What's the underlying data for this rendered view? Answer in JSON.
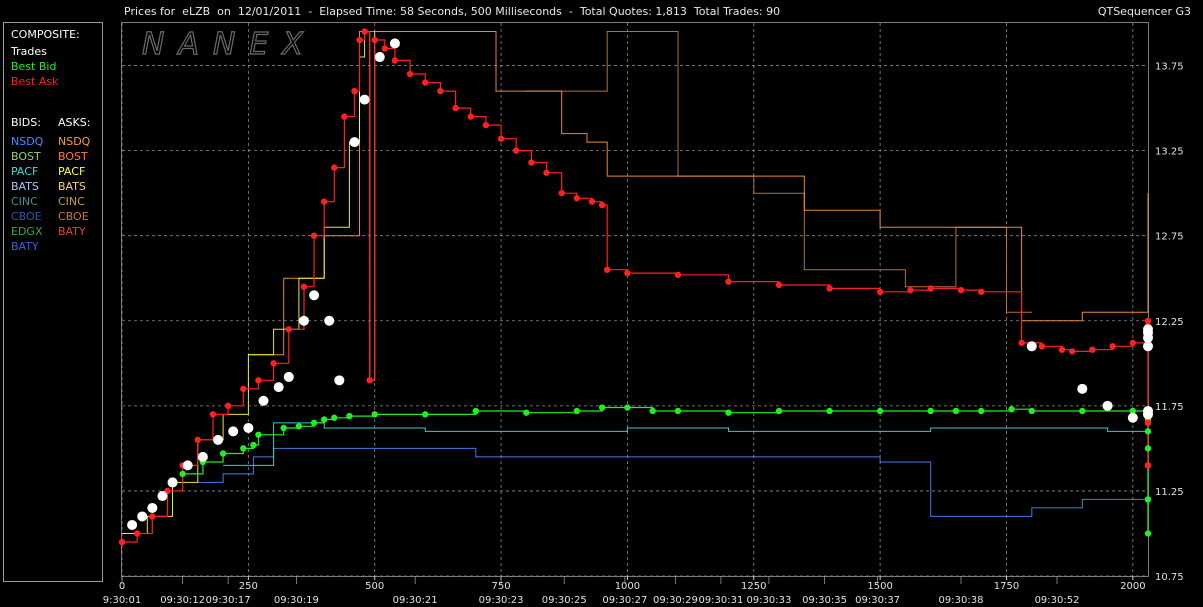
{
  "header": {
    "title": "Prices for  eLZB  on  12/01/2011  -  Elapsed Time: 58 Seconds, 500 Milliseconds  -  Total Quotes: 1,813  Total Trades: 90",
    "app_name": "QTSequencer G3"
  },
  "watermark": "NANEX",
  "legend": {
    "composite_heading": "COMPOSITE:",
    "composite": [
      {
        "label": "Trades",
        "color": "#ffffff"
      },
      {
        "label": "Best Bid",
        "color": "#22ee22"
      },
      {
        "label": "Best Ask",
        "color": "#ff2020"
      }
    ],
    "bids_heading": "BIDS:",
    "asks_heading": "ASKS:",
    "bids": [
      {
        "label": "NSDQ",
        "color": "#4a8cff"
      },
      {
        "label": "BOST",
        "color": "#9ad07a"
      },
      {
        "label": "PACF",
        "color": "#3ee0e0"
      },
      {
        "label": "BATS",
        "color": "#a8c8ff"
      },
      {
        "label": "CINC",
        "color": "#3a8fa0"
      },
      {
        "label": "CBOE",
        "color": "#2a5aa8"
      },
      {
        "label": "EDGX",
        "color": "#3aa83a"
      },
      {
        "label": "BATY",
        "color": "#3a62d8"
      }
    ],
    "asks": [
      {
        "label": "NSDQ",
        "color": "#ff9a3a"
      },
      {
        "label": "BOST",
        "color": "#ff7a3a"
      },
      {
        "label": "PACF",
        "color": "#ffff40"
      },
      {
        "label": "BATS",
        "color": "#ffd070"
      },
      {
        "label": "CINC",
        "color": "#c8a030"
      },
      {
        "label": "CBOE",
        "color": "#c87a40"
      },
      {
        "label": "BATY",
        "color": "#e04040"
      }
    ]
  },
  "chart_data": {
    "type": "line",
    "xlim": [
      0,
      2030
    ],
    "ylim": [
      10.75,
      14.0
    ],
    "grid": true,
    "x_ticks": [
      0,
      250,
      500,
      750,
      1000,
      1250,
      1500,
      1750,
      2000
    ],
    "y_ticks": [
      {
        "value": 10.75,
        "label": "10.75"
      },
      {
        "value": 11.25,
        "label": "11.25"
      },
      {
        "value": 11.75,
        "label": "11.75"
      },
      {
        "value": 12.25,
        "label": "12.25"
      },
      {
        "value": 12.75,
        "label": "12.75"
      },
      {
        "value": 13.25,
        "label": "13.25"
      },
      {
        "value": 13.75,
        "label": "13.75"
      }
    ],
    "time_labels": [
      {
        "x": 0,
        "label": "9:30:01"
      },
      {
        "x": 120,
        "label": "09:30:12"
      },
      {
        "x": 210,
        "label": "09:30:17"
      },
      {
        "x": 345,
        "label": "09:30:19"
      },
      {
        "x": 580,
        "label": "09:30:21"
      },
      {
        "x": 750,
        "label": "09:30:23"
      },
      {
        "x": 875,
        "label": "09:30:25"
      },
      {
        "x": 995,
        "label": "09:30:27"
      },
      {
        "x": 1095,
        "label": "09:30:29"
      },
      {
        "x": 1185,
        "label": "09:30:31"
      },
      {
        "x": 1280,
        "label": "09:30:33"
      },
      {
        "x": 1390,
        "label": "09:30:35"
      },
      {
        "x": 1495,
        "label": "09:30:37"
      },
      {
        "x": 1660,
        "label": "09:30:38"
      },
      {
        "x": 1850,
        "label": "09:30:52"
      }
    ],
    "series": [
      {
        "name": "Best Ask",
        "color": "#ff2020",
        "points": [
          [
            0,
            10.95
          ],
          [
            30,
            11.0
          ],
          [
            60,
            11.1
          ],
          [
            90,
            11.25
          ],
          [
            120,
            11.4
          ],
          [
            150,
            11.55
          ],
          [
            180,
            11.7
          ],
          [
            210,
            11.75
          ],
          [
            240,
            11.85
          ],
          [
            270,
            11.9
          ],
          [
            300,
            12.0
          ],
          [
            330,
            12.2
          ],
          [
            360,
            12.45
          ],
          [
            380,
            12.75
          ],
          [
            400,
            12.95
          ],
          [
            420,
            13.15
          ],
          [
            440,
            13.45
          ],
          [
            460,
            13.6
          ],
          [
            470,
            13.9
          ],
          [
            480,
            13.95
          ],
          [
            490,
            11.9
          ],
          [
            500,
            13.9
          ],
          [
            520,
            13.85
          ],
          [
            540,
            13.78
          ],
          [
            570,
            13.7
          ],
          [
            600,
            13.65
          ],
          [
            630,
            13.6
          ],
          [
            660,
            13.5
          ],
          [
            690,
            13.45
          ],
          [
            720,
            13.4
          ],
          [
            750,
            13.32
          ],
          [
            780,
            13.25
          ],
          [
            810,
            13.18
          ],
          [
            840,
            13.12
          ],
          [
            870,
            13.0
          ],
          [
            900,
            12.97
          ],
          [
            930,
            12.95
          ],
          [
            950,
            12.93
          ],
          [
            960,
            12.55
          ],
          [
            1000,
            12.53
          ],
          [
            1100,
            12.52
          ],
          [
            1200,
            12.48
          ],
          [
            1300,
            12.46
          ],
          [
            1400,
            12.44
          ],
          [
            1500,
            12.42
          ],
          [
            1560,
            12.43
          ],
          [
            1600,
            12.44
          ],
          [
            1660,
            12.43
          ],
          [
            1700,
            12.42
          ],
          [
            1780,
            12.12
          ],
          [
            1820,
            12.1
          ],
          [
            1860,
            12.08
          ],
          [
            1880,
            12.07
          ],
          [
            1920,
            12.08
          ],
          [
            1960,
            12.1
          ],
          [
            2000,
            12.12
          ],
          [
            2040,
            12.14
          ],
          [
            2080,
            12.18
          ],
          [
            2100,
            12.22
          ],
          [
            2110,
            12.25
          ],
          [
            2130,
            12.2
          ],
          [
            2150,
            12.1
          ],
          [
            2165,
            11.65
          ],
          [
            2180,
            12.18
          ],
          [
            2200,
            11.4
          ],
          [
            2230,
            11.4
          ]
        ]
      },
      {
        "name": "Best Bid",
        "color": "#22ee22",
        "points": [
          [
            120,
            11.35
          ],
          [
            160,
            11.42
          ],
          [
            200,
            11.47
          ],
          [
            240,
            11.5
          ],
          [
            260,
            11.52
          ],
          [
            270,
            11.58
          ],
          [
            320,
            11.62
          ],
          [
            350,
            11.63
          ],
          [
            380,
            11.65
          ],
          [
            400,
            11.67
          ],
          [
            420,
            11.68
          ],
          [
            450,
            11.69
          ],
          [
            500,
            11.7
          ],
          [
            600,
            11.7
          ],
          [
            700,
            11.72
          ],
          [
            800,
            11.71
          ],
          [
            900,
            11.72
          ],
          [
            950,
            11.74
          ],
          [
            1000,
            11.74
          ],
          [
            1050,
            11.72
          ],
          [
            1100,
            11.72
          ],
          [
            1200,
            11.71
          ],
          [
            1300,
            11.72
          ],
          [
            1400,
            11.72
          ],
          [
            1500,
            11.72
          ],
          [
            1600,
            11.72
          ],
          [
            1650,
            11.72
          ],
          [
            1700,
            11.72
          ],
          [
            1760,
            11.73
          ],
          [
            1800,
            11.72
          ],
          [
            1900,
            11.72
          ],
          [
            2000,
            11.72
          ],
          [
            2040,
            11.73
          ],
          [
            2060,
            11.7
          ],
          [
            2080,
            11.67
          ],
          [
            2100,
            11.65
          ],
          [
            2120,
            11.6
          ],
          [
            2150,
            11.5
          ],
          [
            2165,
            11.4
          ],
          [
            2175,
            11.2
          ],
          [
            2185,
            11.0
          ]
        ]
      },
      {
        "name": "Trades",
        "color": "#ffffff",
        "points": [
          [
            20,
            11.05
          ],
          [
            40,
            11.1
          ],
          [
            60,
            11.15
          ],
          [
            80,
            11.22
          ],
          [
            100,
            11.3
          ],
          [
            130,
            11.4
          ],
          [
            160,
            11.45
          ],
          [
            190,
            11.55
          ],
          [
            220,
            11.6
          ],
          [
            250,
            11.62
          ],
          [
            280,
            11.78
          ],
          [
            310,
            11.86
          ],
          [
            330,
            11.92
          ],
          [
            360,
            12.25
          ],
          [
            380,
            12.4
          ],
          [
            410,
            12.25
          ],
          [
            430,
            11.9
          ],
          [
            460,
            13.3
          ],
          [
            480,
            13.55
          ],
          [
            510,
            13.8
          ],
          [
            540,
            13.88
          ],
          [
            1800,
            12.1
          ],
          [
            1900,
            11.85
          ],
          [
            1950,
            11.75
          ],
          [
            2000,
            11.68
          ],
          [
            2050,
            11.7
          ],
          [
            2080,
            11.72
          ],
          [
            2100,
            12.1
          ],
          [
            2120,
            12.2
          ],
          [
            2140,
            12.15
          ],
          [
            2160,
            12.18
          ]
        ]
      },
      {
        "name": "BATS",
        "color": "#3ee0e0",
        "points": [
          [
            200,
            11.4
          ],
          [
            250,
            11.4
          ],
          [
            300,
            11.65
          ],
          [
            400,
            11.62
          ],
          [
            600,
            11.6
          ],
          [
            800,
            11.6
          ],
          [
            1000,
            11.62
          ],
          [
            1200,
            11.6
          ],
          [
            1400,
            11.6
          ],
          [
            1600,
            11.62
          ],
          [
            1700,
            11.62
          ],
          [
            1800,
            11.62
          ],
          [
            1950,
            11.6
          ],
          [
            2050,
            11.55
          ],
          [
            2100,
            11.5
          ],
          [
            2150,
            11.3
          ]
        ]
      },
      {
        "name": "NSDQ",
        "color": "#4a8cff",
        "points": [
          [
            150,
            11.3
          ],
          [
            200,
            11.35
          ],
          [
            260,
            11.45
          ],
          [
            300,
            11.5
          ],
          [
            500,
            11.5
          ],
          [
            700,
            11.45
          ],
          [
            900,
            11.45
          ],
          [
            1100,
            11.45
          ],
          [
            1300,
            11.45
          ],
          [
            1500,
            11.42
          ],
          [
            1600,
            11.1
          ],
          [
            1700,
            11.1
          ],
          [
            1800,
            11.15
          ],
          [
            1900,
            11.2
          ],
          [
            2000,
            11.2
          ],
          [
            2100,
            11.2
          ]
        ]
      },
      {
        "name": "PACF",
        "color": "#ffff40",
        "points": [
          [
            0,
            11.0
          ],
          [
            50,
            11.1
          ],
          [
            100,
            11.3
          ],
          [
            150,
            11.55
          ],
          [
            200,
            11.7
          ],
          [
            250,
            12.05
          ],
          [
            300,
            12.2
          ],
          [
            350,
            12.5
          ],
          [
            400,
            12.8
          ],
          [
            450,
            13.3
          ],
          [
            470,
            13.8
          ],
          [
            480,
            13.95
          ],
          [
            490,
            11.9
          ],
          [
            500,
            13.95
          ]
        ]
      },
      {
        "name": "NSDQ",
        "color": "#ff9a3a",
        "points": [
          [
            250,
            12.05
          ],
          [
            320,
            12.5
          ],
          [
            400,
            12.75
          ],
          [
            470,
            13.95
          ],
          [
            700,
            13.95
          ],
          [
            740,
            13.6
          ],
          [
            820,
            13.6
          ],
          [
            870,
            13.35
          ],
          [
            920,
            13.3
          ],
          [
            960,
            13.1
          ],
          [
            1000,
            13.1
          ],
          [
            1050,
            13.1
          ],
          [
            1100,
            13.1
          ],
          [
            1150,
            13.1
          ],
          [
            1300,
            13.1
          ],
          [
            1350,
            12.9
          ],
          [
            1400,
            12.9
          ],
          [
            1500,
            12.8
          ],
          [
            1600,
            12.8
          ],
          [
            1700,
            12.8
          ],
          [
            1780,
            12.25
          ],
          [
            1900,
            12.3
          ],
          [
            2000,
            12.3
          ],
          [
            2050,
            12.6
          ],
          [
            2100,
            13.0
          ],
          [
            2200,
            13.0
          ]
        ]
      },
      {
        "name": "CBOE",
        "color": "#c87a40",
        "points": [
          [
            800,
            13.6
          ],
          [
            900,
            13.6
          ],
          [
            960,
            13.95
          ],
          [
            1000,
            13.95
          ],
          [
            1050,
            13.95
          ],
          [
            1100,
            13.1
          ],
          [
            1150,
            13.1
          ],
          [
            1250,
            13.0
          ],
          [
            1300,
            13.0
          ],
          [
            1350,
            12.55
          ],
          [
            1450,
            12.55
          ],
          [
            1550,
            12.45
          ],
          [
            1600,
            12.45
          ],
          [
            1650,
            12.8
          ],
          [
            1700,
            12.8
          ],
          [
            1750,
            12.3
          ],
          [
            1800,
            12.3
          ]
        ]
      }
    ]
  }
}
